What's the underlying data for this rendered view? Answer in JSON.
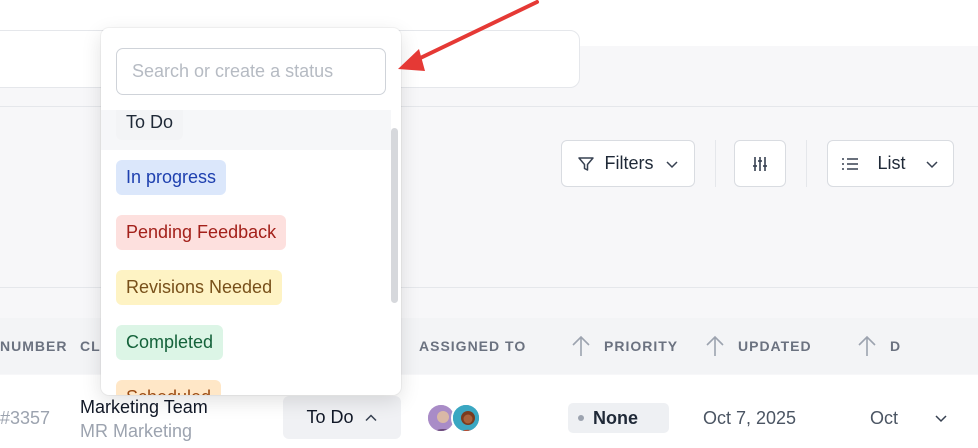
{
  "search": {
    "placeholder": "Search or create a status"
  },
  "statuses": [
    {
      "label": "To Do",
      "bg": "#f3f4f6",
      "fg": "#1f2937"
    },
    {
      "label": "In progress",
      "bg": "#dbe7fb",
      "fg": "#1e40af"
    },
    {
      "label": "Pending Feedback",
      "bg": "#fde0de",
      "fg": "#a3201a"
    },
    {
      "label": "Revisions Needed",
      "bg": "#fef3c4",
      "fg": "#78501a"
    },
    {
      "label": "Completed",
      "bg": "#dcf5e6",
      "fg": "#14623a"
    },
    {
      "label": "Scheduled",
      "bg": "#ffe7c7",
      "fg": "#9a4a12"
    }
  ],
  "toolbar": {
    "filters_label": "Filters",
    "view_label": "List"
  },
  "table": {
    "headers": {
      "number": "NUMBER",
      "client": "CL",
      "assigned_to": "ASSIGNED TO",
      "priority": "PRIORITY",
      "updated": "UPDATED",
      "d": "D"
    },
    "row": {
      "number": "#3357",
      "client_name": "Marketing Team",
      "client_sub": "MR Marketing",
      "status": "To Do",
      "priority": "None",
      "updated": "Oct 7, 2025",
      "due": "Oct"
    }
  },
  "colors": {
    "accent_arrow": "#e53935"
  }
}
